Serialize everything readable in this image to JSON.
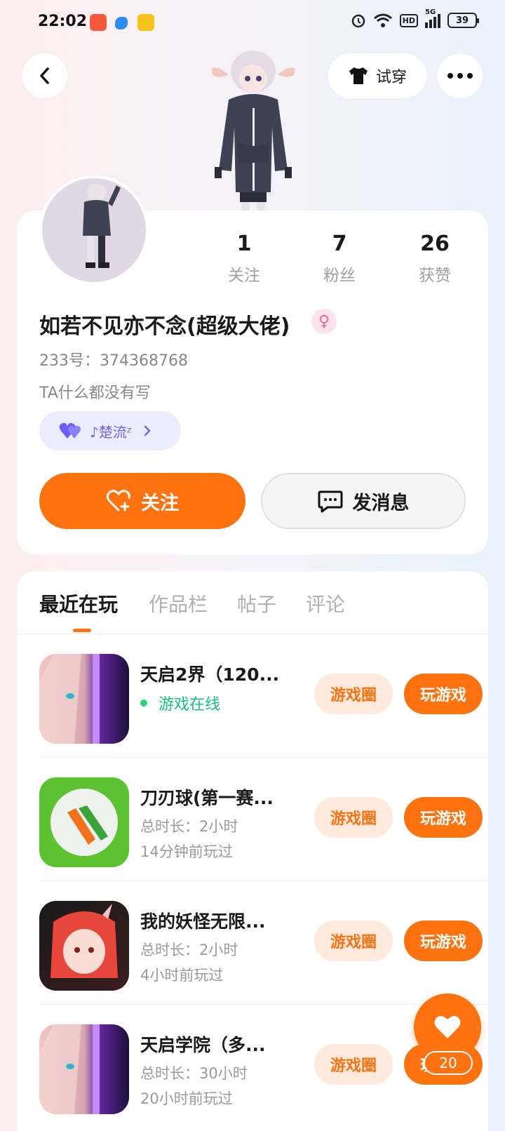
{
  "status_bar": {
    "time": "22:02",
    "battery": "39",
    "network": "5G",
    "hd": "HD",
    "icons": [
      "alarm-icon",
      "wifi-icon",
      "hd-icon",
      "signal-icon",
      "battery-icon"
    ]
  },
  "header": {
    "back_icon": "chevron-left-icon",
    "tryon_label": "试穿",
    "more_icon": "more-icon"
  },
  "profile": {
    "stats": [
      {
        "value": "1",
        "label": "关注"
      },
      {
        "value": "7",
        "label": "粉丝"
      },
      {
        "value": "26",
        "label": "获赞"
      }
    ],
    "nickname": "如若不见亦不念(超级大佬)",
    "gender_icon": "female-icon",
    "uid": "233号：374368768",
    "bio": "TA什么都没有写",
    "tag_label": "♪楚流ᶻ",
    "follow_label": "关注",
    "message_label": "发消息"
  },
  "tabs": [
    {
      "label": "最近在玩",
      "active": true
    },
    {
      "label": "作品栏",
      "active": false
    },
    {
      "label": "帖子",
      "active": false
    },
    {
      "label": "评论",
      "active": false
    }
  ],
  "games": [
    {
      "title": "天启2界（120...",
      "status": "游戏在线",
      "line1": "",
      "line2": "",
      "circle_label": "游戏圈",
      "play_label": "玩游戏"
    },
    {
      "title": "刀刃球(第一赛...",
      "status": "",
      "line1": "总时长：2小时",
      "line2": "14分钟前玩过",
      "circle_label": "游戏圈",
      "play_label": "玩游戏"
    },
    {
      "title": "我的妖怪无限...",
      "status": "",
      "line1": "总时长：2小时",
      "line2": "4小时前玩过",
      "circle_label": "游戏圈",
      "play_label": "玩游戏"
    },
    {
      "title": "天启学院（多...",
      "status": "",
      "line1": "总时长：30小时",
      "line2": "20小时前玩过",
      "circle_label": "游戏圈",
      "play_label": "玩游戏"
    }
  ],
  "like_fab": {
    "count": "20"
  },
  "colors": {
    "accent": "#ff7210",
    "online": "#19c07b",
    "tag": "#7168e0"
  }
}
